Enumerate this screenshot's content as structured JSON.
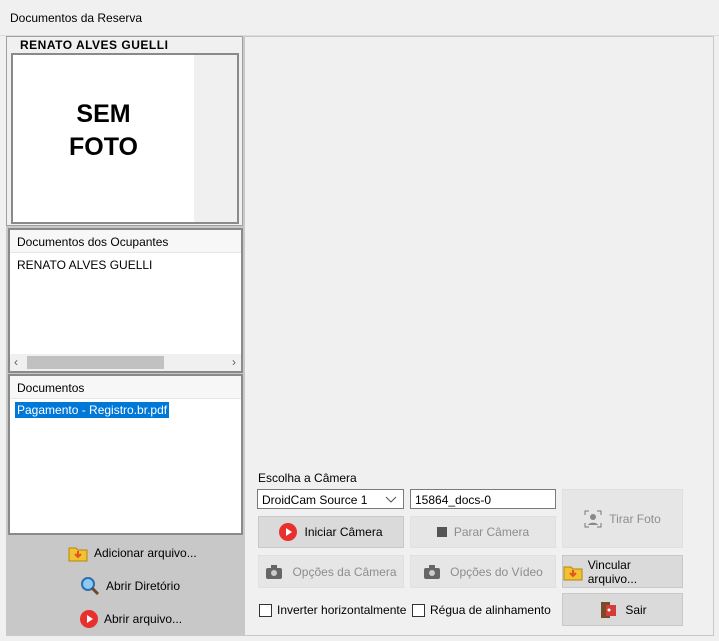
{
  "window": {
    "title": "Documentos da Reserva"
  },
  "guest": {
    "name": "RENATO ALVES GUELLI",
    "photo_placeholder_line1": "SEM",
    "photo_placeholder_line2": "FOTO"
  },
  "occupants": {
    "header": "Documentos dos Ocupantes",
    "items": [
      "RENATO ALVES GUELLI"
    ]
  },
  "documents": {
    "header": "Documentos",
    "items": [
      "Pagamento - Registro.br.pdf"
    ],
    "selected_index": 0
  },
  "left_actions": {
    "add_file": "Adicionar arquivo...",
    "open_dir": "Abrir Diretório",
    "open_file": "Abrir arquivo..."
  },
  "camera": {
    "choose_label": "Escolha a Câmera",
    "selected_camera": "DroidCam Source 1",
    "filename": "15864_docs-0",
    "start": "Iniciar Câmera",
    "stop": "Parar Câmera",
    "take_photo": "Tirar Foto",
    "camera_options": "Opções da Câmera",
    "video_options": "Opções do Vídeo",
    "link_file": "Vincular arquivo...",
    "flip_horizontal": "Inverter horizontalmente",
    "alignment_ruler": "Régua de alinhamento",
    "exit": "Sair"
  },
  "colors": {
    "selection": "#0078d7",
    "record_red": "#e8312f",
    "folder_yellow": "#f2c230"
  }
}
